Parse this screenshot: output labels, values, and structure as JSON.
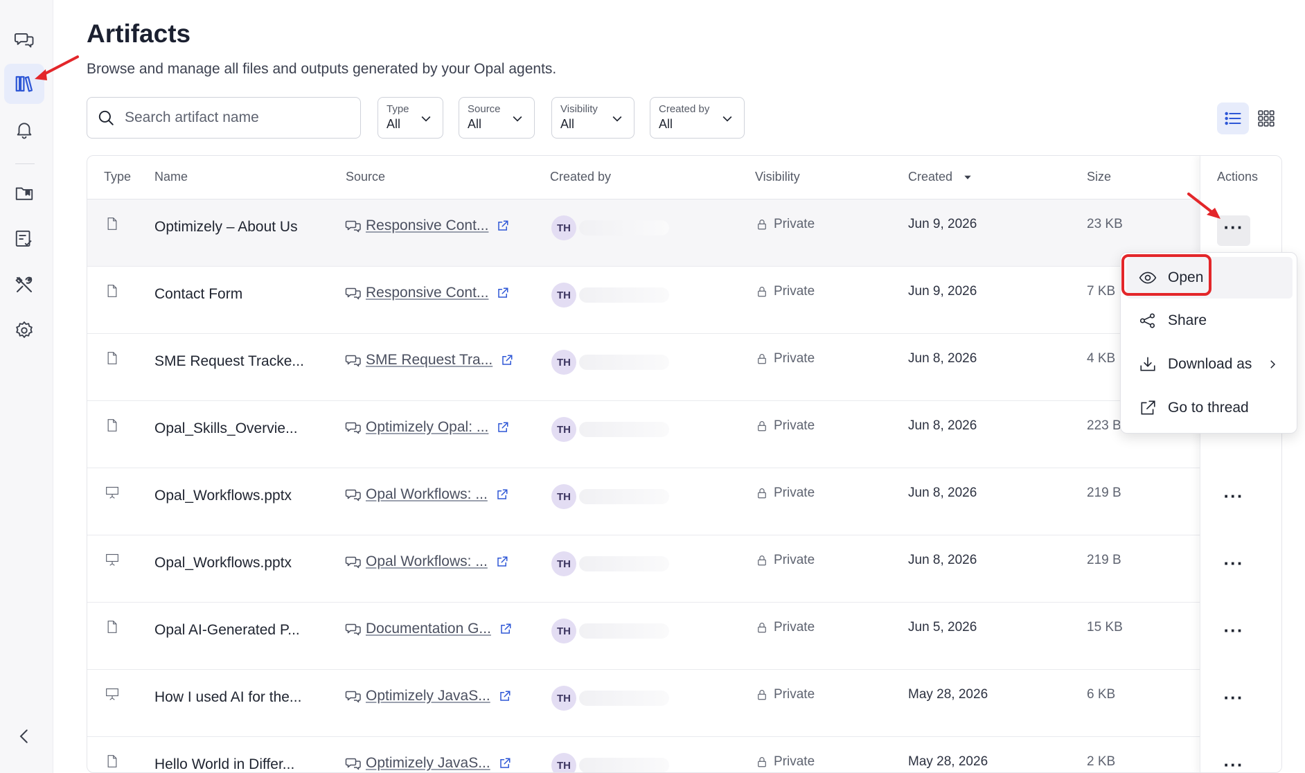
{
  "sidebar": {
    "items": [
      {
        "name": "chat",
        "icon": "chat-bubbles-icon"
      },
      {
        "name": "artifacts",
        "icon": "library-books-icon",
        "active": true
      },
      {
        "name": "notifications",
        "icon": "bell-icon"
      },
      {
        "name": "folder",
        "icon": "folder-bookmark-icon"
      },
      {
        "name": "tasks",
        "icon": "checklist-icon"
      },
      {
        "name": "tools",
        "icon": "tools-icon"
      },
      {
        "name": "settings",
        "icon": "gear-icon"
      }
    ],
    "collapse_icon": "chevron-left-icon"
  },
  "header": {
    "title": "Artifacts",
    "subtitle": "Browse and manage all files and outputs generated by your Opal agents."
  },
  "filters": {
    "search_placeholder": "Search artifact name",
    "type": {
      "label": "Type",
      "value": "All"
    },
    "source": {
      "label": "Source",
      "value": "All"
    },
    "visibility": {
      "label": "Visibility",
      "value": "All"
    },
    "created_by": {
      "label": "Created by",
      "value": "All"
    }
  },
  "view": {
    "list_icon": "list-view-icon",
    "grid_icon": "grid-view-icon",
    "active": "list"
  },
  "table": {
    "columns": {
      "type": "Type",
      "name": "Name",
      "source": "Source",
      "created_by": "Created by",
      "visibility": "Visibility",
      "created": "Created",
      "size": "Size",
      "actions": "Actions"
    },
    "sort_column": "created",
    "rows": [
      {
        "type_icon": "document-icon",
        "name": "Optimizely – About Us",
        "source": "Responsive Cont...",
        "initials": "TH",
        "visibility": "Private",
        "created": "Jun 9, 2026",
        "size": "23 KB"
      },
      {
        "type_icon": "document-icon",
        "name": "Contact Form",
        "source": "Responsive Cont...",
        "initials": "TH",
        "visibility": "Private",
        "created": "Jun 9, 2026",
        "size": "7 KB"
      },
      {
        "type_icon": "document-icon",
        "name": "SME Request Tracke...",
        "source": "SME Request Tra...",
        "initials": "TH",
        "visibility": "Private",
        "created": "Jun 8, 2026",
        "size": "4 KB"
      },
      {
        "type_icon": "document-icon",
        "name": "Opal_Skills_Overvie...",
        "source": "Optimizely Opal: ...",
        "initials": "TH",
        "visibility": "Private",
        "created": "Jun 8, 2026",
        "size": "223 B"
      },
      {
        "type_icon": "presentation-icon",
        "name": "Opal_Workflows.pptx",
        "source": "Opal Workflows: ...",
        "initials": "TH",
        "visibility": "Private",
        "created": "Jun 8, 2026",
        "size": "219 B"
      },
      {
        "type_icon": "presentation-icon",
        "name": "Opal_Workflows.pptx",
        "source": "Opal Workflows: ...",
        "initials": "TH",
        "visibility": "Private",
        "created": "Jun 8, 2026",
        "size": "219 B"
      },
      {
        "type_icon": "document-icon",
        "name": "Opal AI-Generated P...",
        "source": "Documentation G...",
        "initials": "TH",
        "visibility": "Private",
        "created": "Jun 5, 2026",
        "size": "15 KB"
      },
      {
        "type_icon": "presentation-icon",
        "name": "How I used AI for the...",
        "source": "Optimizely JavaS...",
        "initials": "TH",
        "visibility": "Private",
        "created": "May 28, 2026",
        "size": "6 KB"
      },
      {
        "type_icon": "document-icon",
        "name": "Hello World in Differ...",
        "source": "Optimizely JavaS...",
        "initials": "TH",
        "visibility": "Private",
        "created": "May 28, 2026",
        "size": "2 KB"
      }
    ]
  },
  "action_menu": {
    "items": [
      {
        "label": "Open",
        "icon": "eye-icon"
      },
      {
        "label": "Share",
        "icon": "share-icon"
      },
      {
        "label": "Download as",
        "icon": "download-icon"
      },
      {
        "label": "Go to thread",
        "icon": "external-link-icon"
      }
    ]
  },
  "colors": {
    "accent": "#2e57d6",
    "annotation": "#e3262a",
    "avatar_bg": "#e3ddf3"
  }
}
